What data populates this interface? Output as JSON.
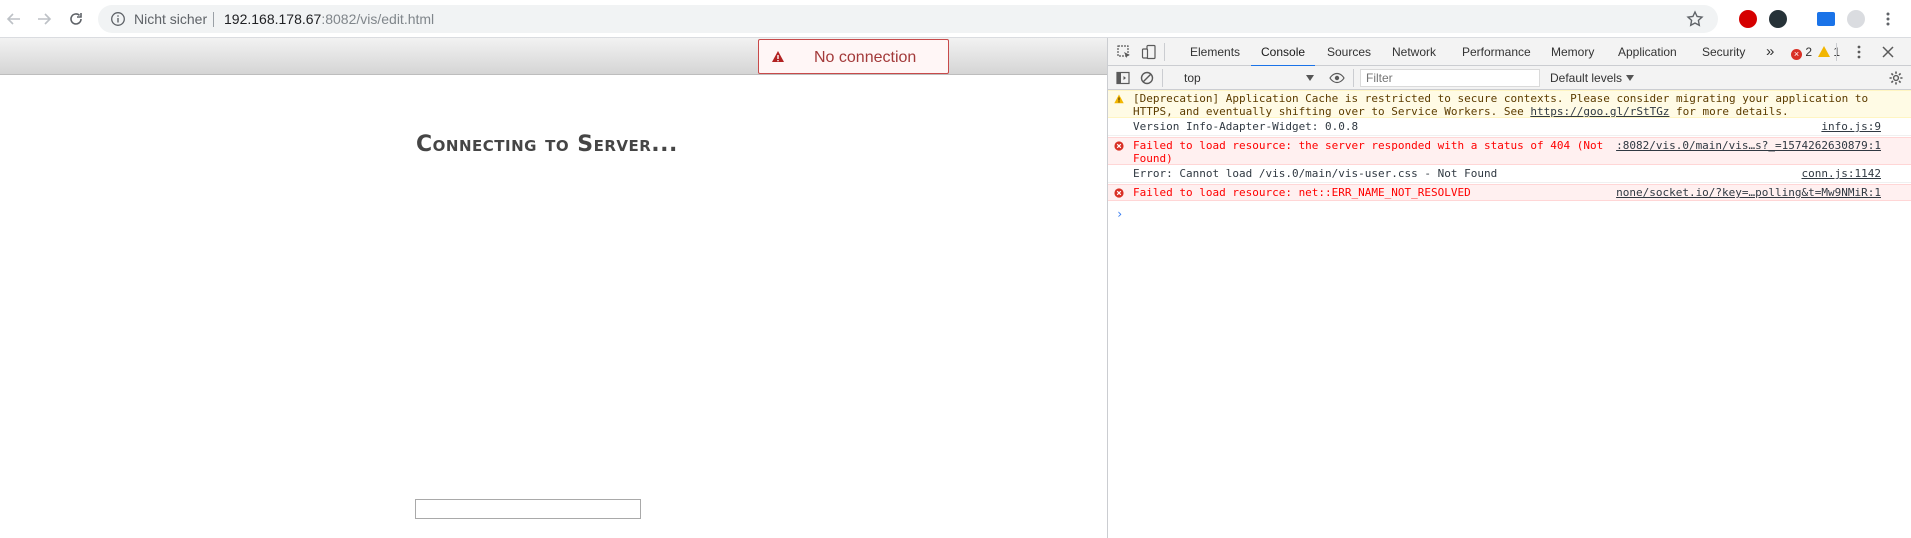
{
  "browser": {
    "insecure_label": "Nicht sicher",
    "url_host": "192.168.178.67",
    "url_rest": ":8082/vis/edit.html"
  },
  "page": {
    "banner_text": "No connection",
    "heading": "Connecting to Server..."
  },
  "devtools": {
    "tabs": [
      "Elements",
      "Console",
      "Sources",
      "Network",
      "Performance",
      "Memory",
      "Application",
      "Security"
    ],
    "active_tab": "Console",
    "more_tabs": "»",
    "error_count": "2",
    "warning_count": "1",
    "context": "top",
    "filter_placeholder": "Filter",
    "levels_label": "Default levels",
    "messages": [
      {
        "level": "warning",
        "line1": "[Deprecation] Application Cache is restricted to secure contexts. Please consider migrating your application to",
        "line2_pre": "HTTPS, and eventually shifting over to Service Workers. See ",
        "line2_link": "https://goo.gl/rStTGz",
        "line2_post": " for more details.",
        "source": ""
      },
      {
        "level": "info",
        "text": "Version Info-Adapter-Widget: 0.0.8",
        "source": "info.js:9"
      },
      {
        "level": "error",
        "line1": "Failed to load resource: the server responded with a status of 404 (Not",
        "line2": "Found)",
        "source": ":8082/vis.0/main/vis…s?_=1574262630879:1"
      },
      {
        "level": "info",
        "text": "Error: Cannot load /vis.0/main/vis-user.css - Not Found",
        "source": "conn.js:1142"
      },
      {
        "level": "error",
        "text": "Failed to load resource: net::ERR_NAME_NOT_RESOLVED",
        "source": "none/socket.io/?key=…polling&t=Mw9NMiR:1"
      }
    ],
    "prompt": "›"
  }
}
